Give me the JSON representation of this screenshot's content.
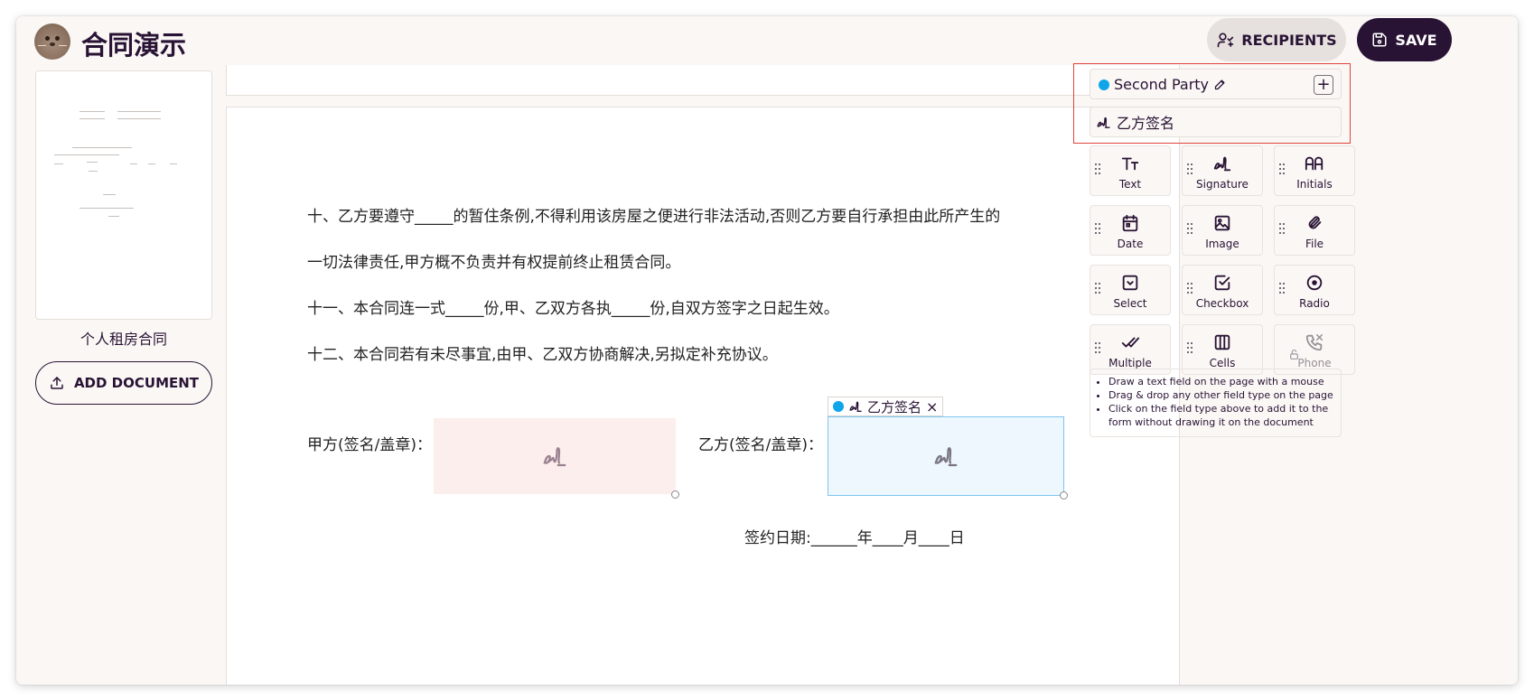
{
  "header": {
    "app_title": "合同演示",
    "recipients_label": "RECIPIENTS",
    "save_label": "SAVE"
  },
  "sidebar": {
    "document_name": "个人租房合同",
    "add_document_label": "ADD DOCUMENT"
  },
  "document": {
    "lines": [
      "十、乙方要遵守_____的暂住条例,不得利用该房屋之便进行非法活动,否则乙方要自行承担由此所产生的",
      "一切法律责任,甲方概不负责并有权提前终止租赁合同。",
      "十一、本合同连一式_____份,甲、乙双方各执_____份,自双方签字之日起生效。",
      "十二、本合同若有未尽事宜,由甲、乙双方协商解决,另拟定补充协议。"
    ],
    "first_party_label": "甲方(签名/盖章)：",
    "second_party_label": "乙方(签名/盖章)：",
    "date_line": "签约日期:______年____月____日",
    "selected_field_tag": "乙方签名",
    "close_symbol": "×"
  },
  "panel": {
    "party_name": "Second Party",
    "add_symbol": "+",
    "field_item": "乙方签名",
    "tools": [
      {
        "label": "Text",
        "icon": "text-icon"
      },
      {
        "label": "Signature",
        "icon": "signature-icon"
      },
      {
        "label": "Initials",
        "icon": "initials-icon"
      },
      {
        "label": "Date",
        "icon": "calendar-icon"
      },
      {
        "label": "Image",
        "icon": "image-icon"
      },
      {
        "label": "File",
        "icon": "paperclip-icon"
      },
      {
        "label": "Select",
        "icon": "select-icon"
      },
      {
        "label": "Checkbox",
        "icon": "checkbox-icon"
      },
      {
        "label": "Radio",
        "icon": "radio-icon"
      },
      {
        "label": "Multiple",
        "icon": "double-check-icon"
      },
      {
        "label": "Cells",
        "icon": "cells-icon"
      },
      {
        "label": "Phone",
        "icon": "phone-icon"
      }
    ],
    "tips": [
      "Draw a text field on the page with a mouse",
      "Drag & drop any other field type on the page",
      "Click on the field type above to add it to the form without drawing it on the document"
    ]
  },
  "colors": {
    "brand": "#291334",
    "party_dot": "#0ea5e9",
    "first_party_field": "#fdeeee",
    "second_party_field": "#eef7fd",
    "highlight_border": "#e0433c"
  }
}
